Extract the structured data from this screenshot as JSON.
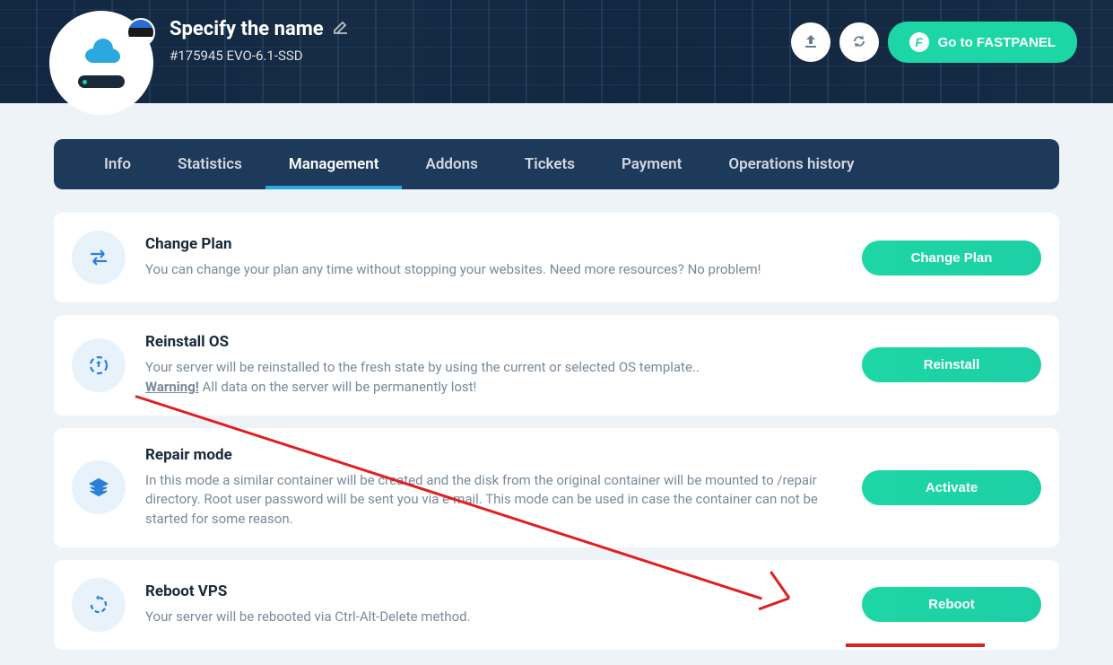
{
  "header": {
    "title": "Specify the name",
    "subtitle": "#175945 EVO-6.1-SSD",
    "fastpanel_label": "Go to FASTPANEL",
    "fp_badge": "F",
    "flag_colors": [
      "#2a6dd4",
      "#1a1a1a",
      "#ffffff"
    ]
  },
  "tabs": [
    {
      "label": "Info",
      "active": false
    },
    {
      "label": "Statistics",
      "active": false
    },
    {
      "label": "Management",
      "active": true
    },
    {
      "label": "Addons",
      "active": false
    },
    {
      "label": "Tickets",
      "active": false
    },
    {
      "label": "Payment",
      "active": false
    },
    {
      "label": "Operations history",
      "active": false
    }
  ],
  "cards": [
    {
      "icon": "swap",
      "title": "Change Plan",
      "desc": "You can change your plan any time without stopping your websites. Need more resources? No problem!",
      "button": "Change Plan"
    },
    {
      "icon": "refresh-dashed",
      "title": "Reinstall OS",
      "desc": "Your server will be reinstalled to the fresh state by using the current or selected OS template..",
      "warning_label": "Warning!",
      "warning_text": " All data on the server will be permanently lost!",
      "button": "Reinstall"
    },
    {
      "icon": "layers",
      "title": "Repair mode",
      "desc": "In this mode a similar container will be created and the disk from the original container will be mounted to /repair directory. Root user password will be sent you via e-mail. This mode can be used in case the container can not be started for some reason.",
      "button": "Activate"
    },
    {
      "icon": "rotate-dashed",
      "title": "Reboot VPS",
      "desc": "Your server will be rebooted via Ctrl-Alt-Delete method.",
      "button": "Reboot"
    }
  ]
}
